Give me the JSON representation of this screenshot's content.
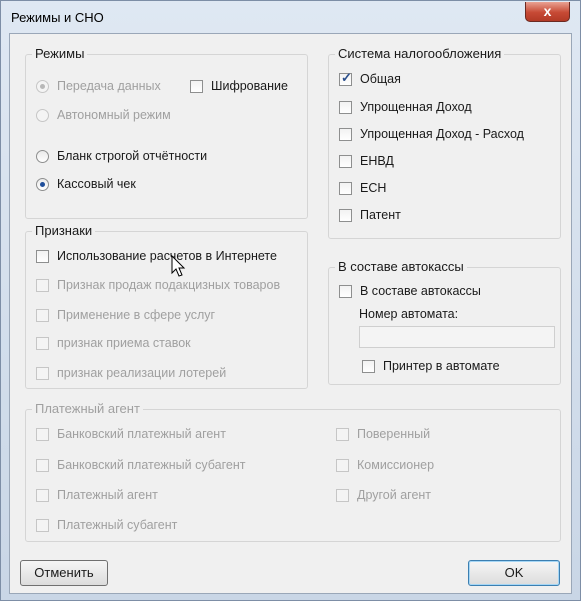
{
  "window": {
    "title": "Режимы и СНО",
    "close_glyph": "x"
  },
  "modes": {
    "legend": "Режимы",
    "data_transfer": "Передача данных",
    "encryption": "Шифрование",
    "autonomous": "Автономный режим",
    "strict_form": "Бланк строгой отчётности",
    "cash_receipt": "Кассовый чек"
  },
  "tax_system": {
    "legend": "Система налогообложения",
    "items": [
      "Общая",
      "Упрощенная Доход",
      "Упрощенная Доход - Расход",
      "ЕНВД",
      "ЕСН",
      "Патент"
    ],
    "checked": [
      true,
      false,
      false,
      false,
      false,
      false
    ]
  },
  "signs": {
    "legend": "Признаки",
    "items": [
      "Использование расчетов в Интернете",
      "Признак продаж подакцизных товаров",
      "Применение в сфере услуг",
      "признак приема ставок",
      "признак реализации лотерей"
    ]
  },
  "autokassa": {
    "legend": "В составе автокассы",
    "checkbox": "В составе автокассы",
    "number_label": "Номер автомата:",
    "number_value": "",
    "printer": "Принтер в автомате"
  },
  "payment_agent": {
    "legend": "Платежный агент",
    "left": [
      "Банковский платежный агент",
      "Банковский платежный субагент",
      "Платежный агент",
      "Платежный субагент"
    ],
    "right": [
      "Поверенный",
      "Комиссионер",
      "Другой агент"
    ]
  },
  "buttons": {
    "cancel": "Отменить",
    "ok": "OK"
  }
}
